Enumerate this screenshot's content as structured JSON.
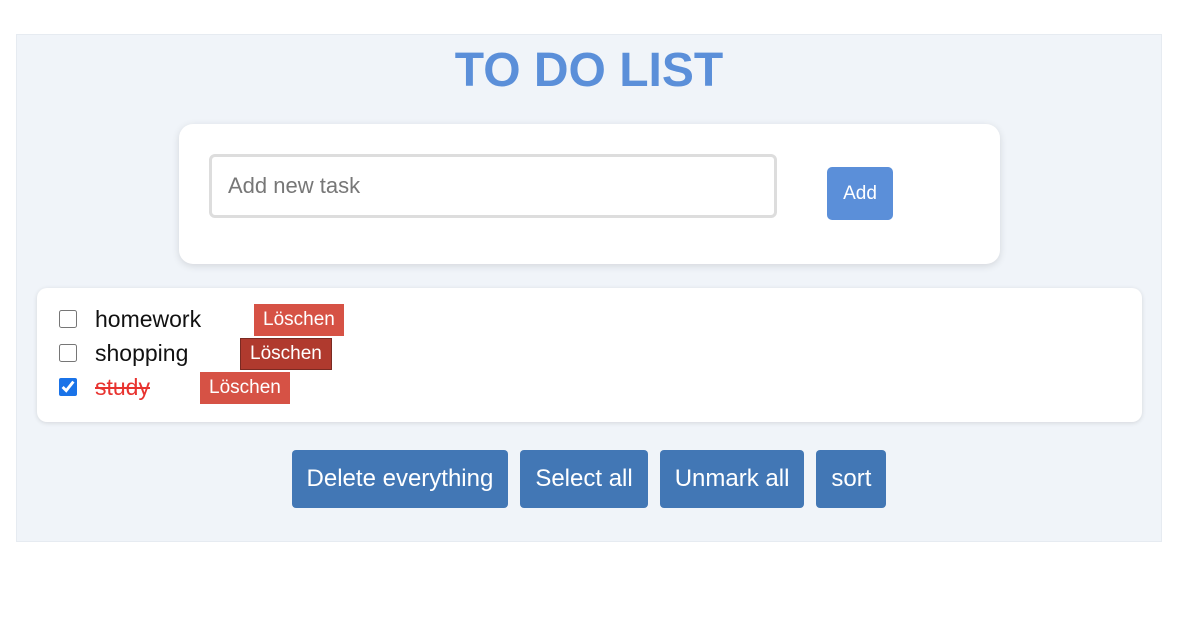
{
  "header": {
    "title": "TO DO LIST"
  },
  "new_task": {
    "value": "",
    "placeholder": "Add new task",
    "add_label": "Add"
  },
  "tasks": [
    {
      "text": "homework",
      "checked": false,
      "delete_label": "Löschen"
    },
    {
      "text": "shopping",
      "checked": false,
      "delete_label": "Löschen"
    },
    {
      "text": "study",
      "checked": true,
      "delete_label": "Löschen"
    }
  ],
  "actions": {
    "delete_all": "Delete everything",
    "select_all": "Select all",
    "unmark_all": "Unmark all",
    "sort": "sort"
  },
  "colors": {
    "title": "#5b8fd9",
    "add_button": "#5b8fd9",
    "delete_button": "#d65245",
    "delete_button_hover": "#b03a2e",
    "completed_text": "#e8332f",
    "action_button": "#4277b5",
    "panel_background": "#f0f4f9"
  }
}
